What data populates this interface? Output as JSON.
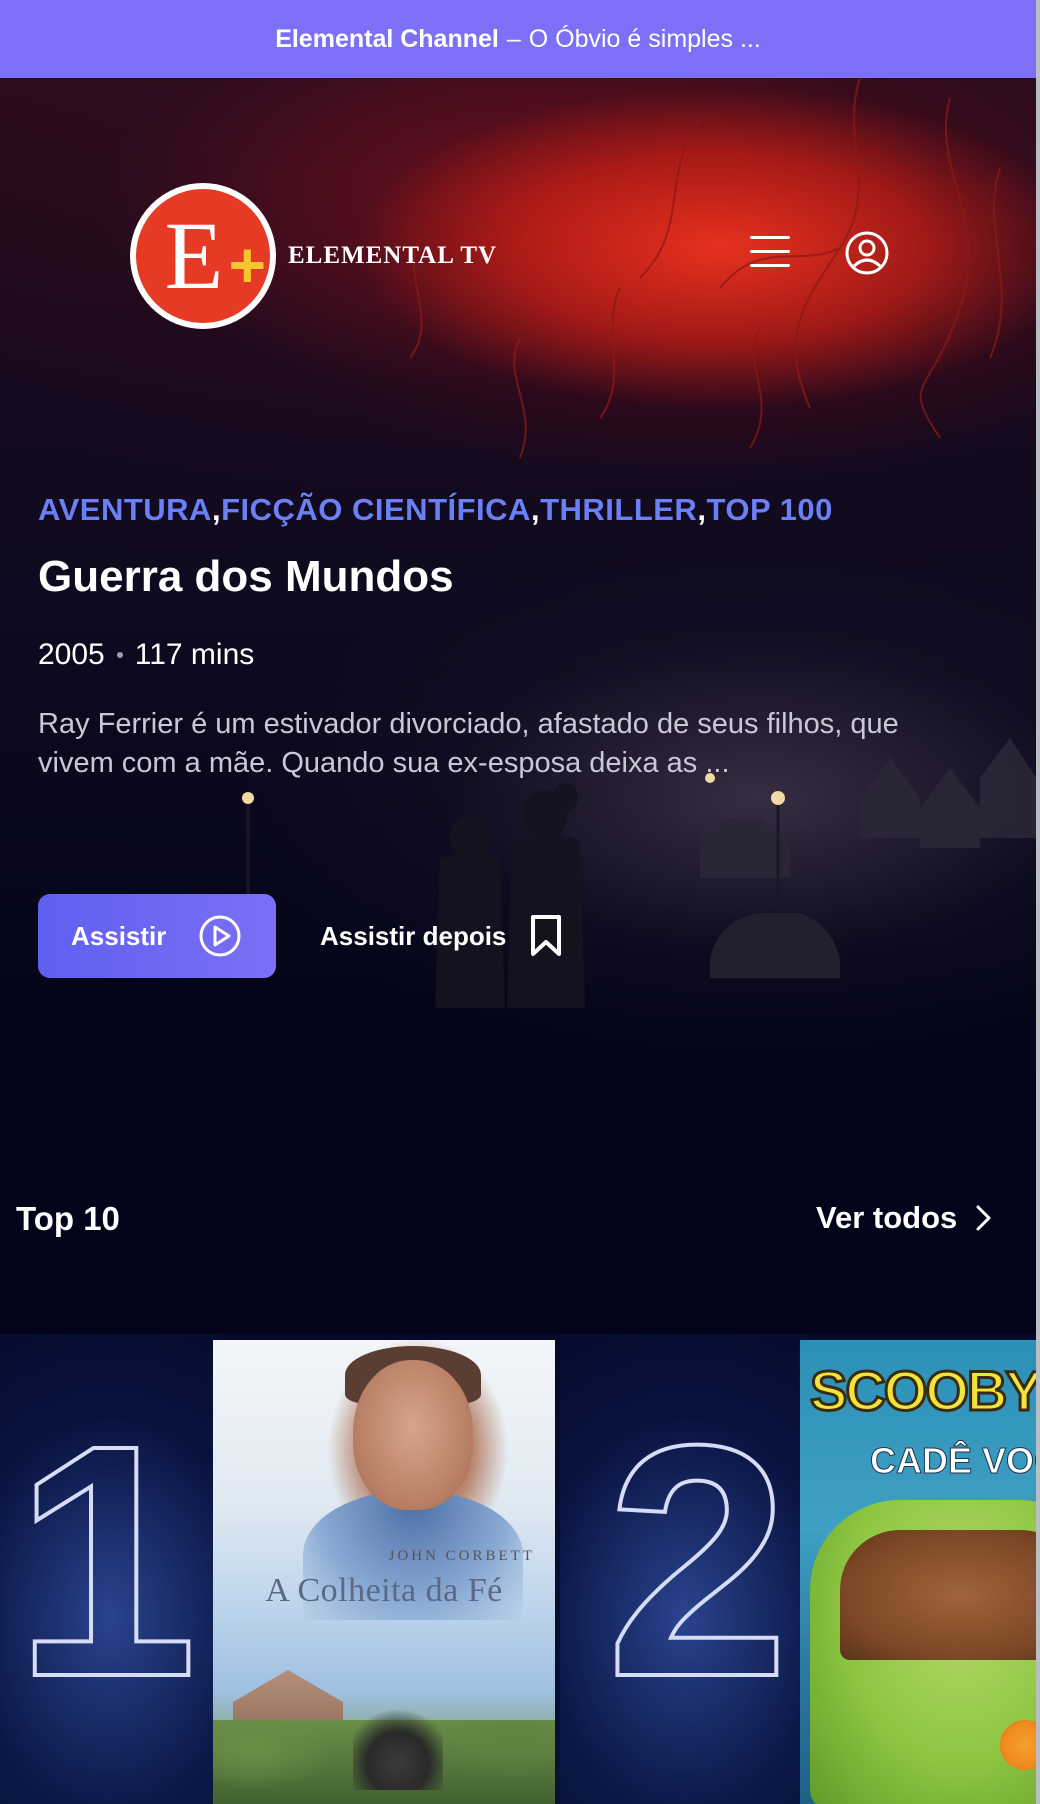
{
  "banner": {
    "brand": "Elemental Channel",
    "separator": "–",
    "tagline": "O Óbvio é simples ..."
  },
  "header": {
    "logo_letter": "E",
    "logo_plus": "+",
    "logo_text": "ELEMENTAL TV",
    "menu_icon": "hamburger-menu-icon",
    "user_icon": "user-circle-icon"
  },
  "hero": {
    "genres": [
      "AVENTURA",
      "FICÇÃO CIENTÍFICA",
      "THRILLER",
      "TOP 100"
    ],
    "genre_separator": ",",
    "title": "Guerra dos Mundos",
    "year": "2005",
    "duration": "117 mins",
    "synopsis": "Ray Ferrier é um estivador divorciado, afastado de seus filhos, que vivem com a mãe. Quando sua ex-esposa deixa as ...",
    "play_label": "Assistir",
    "watch_later_label": "Assistir depois",
    "accent_color": "#6b7ff6"
  },
  "top10": {
    "section_title": "Top 10",
    "see_all_label": "Ver todos",
    "items": [
      {
        "rank": "1",
        "poster_actor": "JOHN CORBETT",
        "poster_title": "A Colheita da Fé"
      },
      {
        "rank": "2",
        "poster_title": "SCOOBY-D",
        "poster_subtitle": "CADÊ VOC"
      }
    ]
  },
  "colors": {
    "banner": "#7b70f6",
    "background": "#03031a",
    "button_gradient_start": "#5f5ff0",
    "button_gradient_end": "#7b70f6"
  }
}
